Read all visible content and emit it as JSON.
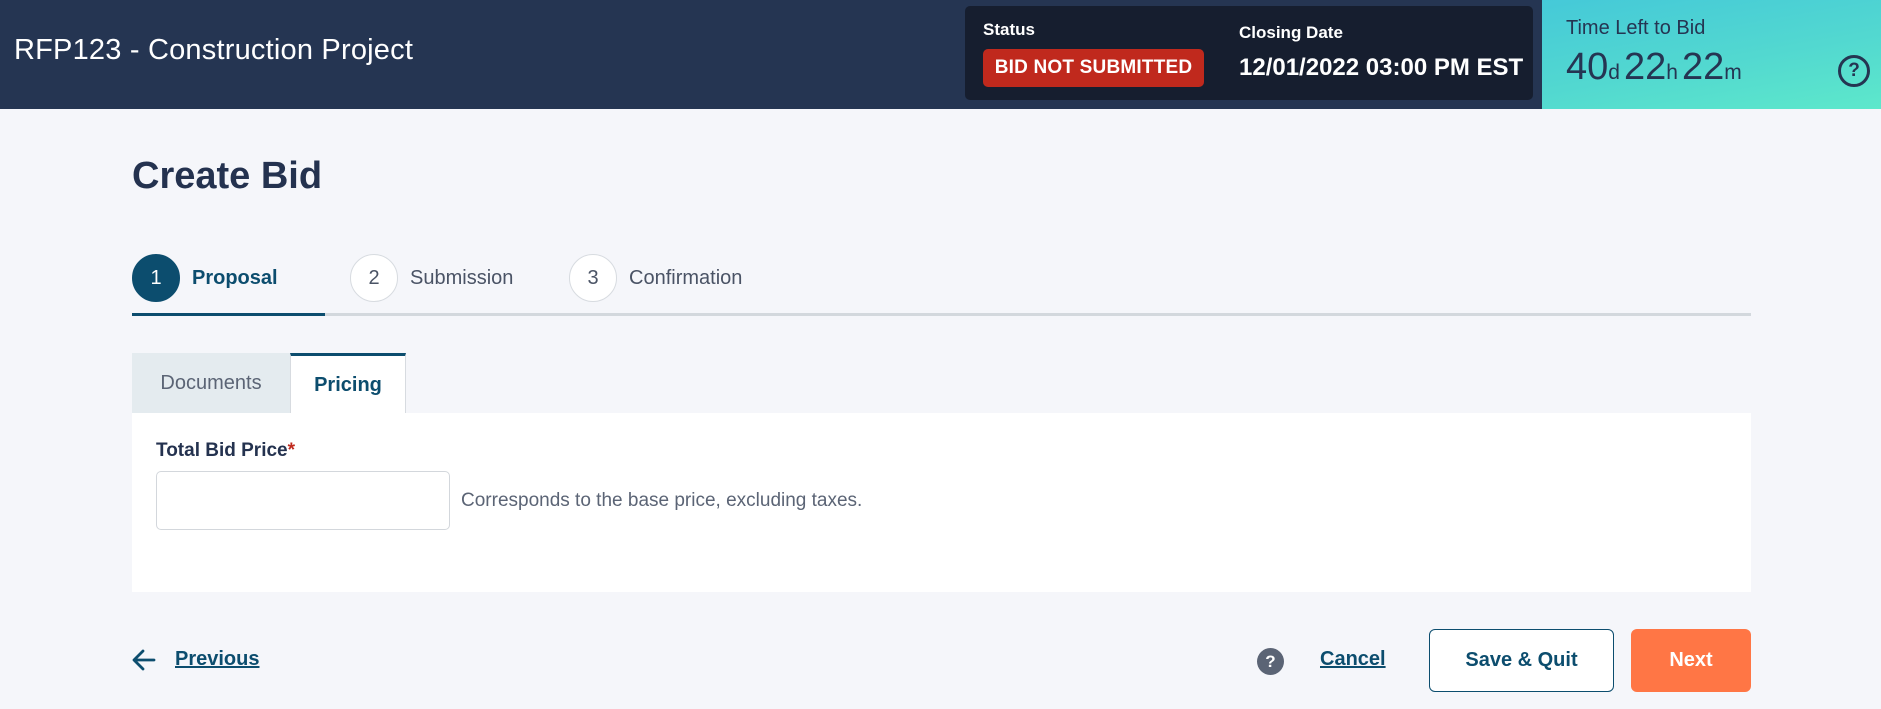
{
  "header": {
    "title": "RFP123 - Construction Project",
    "status_label": "Status",
    "status_badge": "BID NOT SUBMITTED",
    "closing_label": "Closing Date",
    "closing_value": "12/01/2022 03:00 PM EST"
  },
  "timer": {
    "label": "Time Left to Bid",
    "days": "40",
    "days_unit": "d",
    "hours": "22",
    "hours_unit": "h",
    "minutes": "22",
    "minutes_unit": "m",
    "help_icon": "?"
  },
  "page": {
    "title": "Create Bid"
  },
  "stepper": {
    "steps": [
      {
        "number": "1",
        "label": "Proposal",
        "active": true
      },
      {
        "number": "2",
        "label": "Submission",
        "active": false
      },
      {
        "number": "3",
        "label": "Confirmation",
        "active": false
      }
    ]
  },
  "tabs": [
    {
      "label": "Documents",
      "active": false
    },
    {
      "label": "Pricing",
      "active": true
    }
  ],
  "form": {
    "total_bid_price_label": "Total Bid Price",
    "required_mark": "*",
    "total_bid_price_value": "",
    "total_bid_price_hint": "Corresponds to the base price, excluding taxes."
  },
  "footer": {
    "previous_label": "Previous",
    "help_icon": "?",
    "cancel_label": "Cancel",
    "save_quit_label": "Save & Quit",
    "next_label": "Next"
  },
  "colors": {
    "header_bg": "#253552",
    "status_box_bg": "#161e2f",
    "status_badge_bg": "#c0291d",
    "accent": "#0c4d6e",
    "next_button": "#ff7645",
    "timer_gradient_start": "#45c9d8",
    "timer_gradient_end": "#5de8cb"
  }
}
